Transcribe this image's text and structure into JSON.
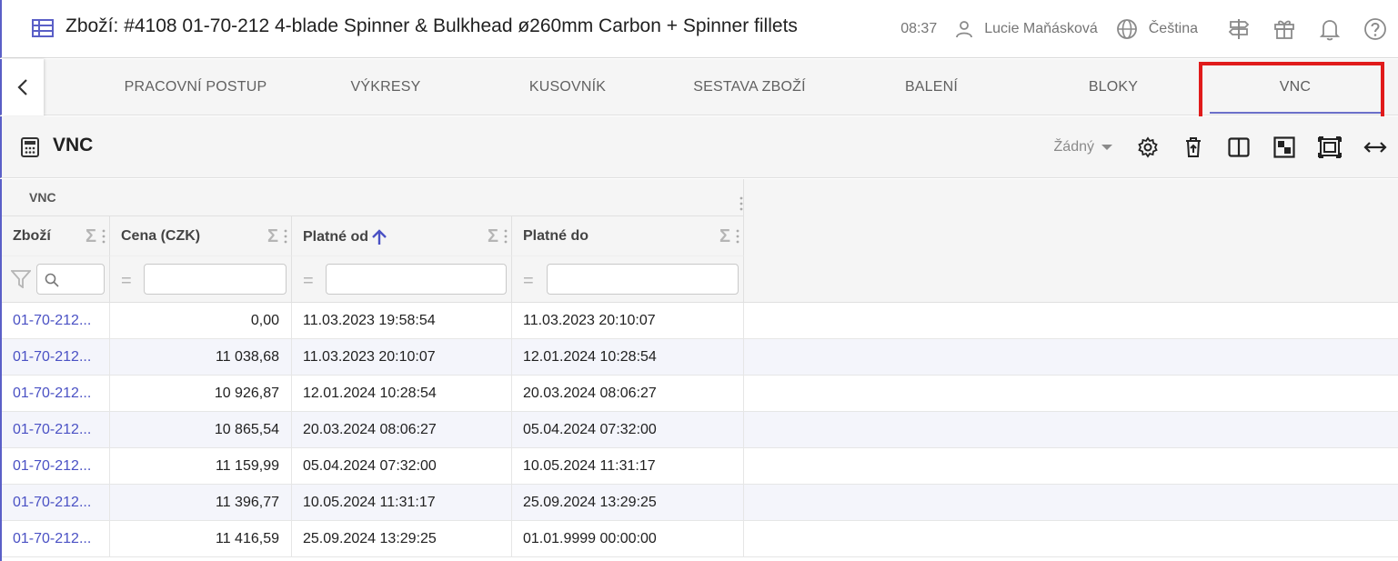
{
  "header": {
    "title": "Zboží: #4108 01-70-212 4-blade Spinner & Bulkhead ø260mm Carbon + Spinner fillets",
    "time": "08:37",
    "user": "Lucie Maňásková",
    "language": "Čeština",
    "icons": [
      "signpost-icon",
      "gift-icon",
      "bell-icon",
      "help-icon"
    ]
  },
  "tabs": [
    {
      "label": "PRACOVNÍ POSTUP"
    },
    {
      "label": "VÝKRESY"
    },
    {
      "label": "KUSOVNÍK"
    },
    {
      "label": "SESTAVA ZBOŽÍ"
    },
    {
      "label": "BALENÍ"
    },
    {
      "label": "BLOKY"
    },
    {
      "label": "VNC",
      "active": true
    }
  ],
  "panel": {
    "title": "VNC",
    "preset": "Žádný",
    "tool_icons": [
      "settings-icon",
      "delete-icon",
      "split-view-icon",
      "layout-icon",
      "fullscreen-icon",
      "expand-width-icon"
    ]
  },
  "grid": {
    "group_label": "VNC",
    "columns": [
      {
        "label": "Zboží"
      },
      {
        "label": "Cena (CZK)"
      },
      {
        "label": "Platné od",
        "sort": "asc"
      },
      {
        "label": "Platné do"
      }
    ],
    "rows": [
      {
        "item": "01-70-212...",
        "price": "0,00",
        "from": "11.03.2023 19:58:54",
        "to": "11.03.2023 20:10:07"
      },
      {
        "item": "01-70-212...",
        "price": "11 038,68",
        "from": "11.03.2023 20:10:07",
        "to": "12.01.2024 10:28:54"
      },
      {
        "item": "01-70-212...",
        "price": "10 926,87",
        "from": "12.01.2024 10:28:54",
        "to": "20.03.2024 08:06:27"
      },
      {
        "item": "01-70-212...",
        "price": "10 865,54",
        "from": "20.03.2024 08:06:27",
        "to": "05.04.2024 07:32:00"
      },
      {
        "item": "01-70-212...",
        "price": "11 159,99",
        "from": "05.04.2024 07:32:00",
        "to": "10.05.2024 11:31:17"
      },
      {
        "item": "01-70-212...",
        "price": "11 396,77",
        "from": "10.05.2024 11:31:17",
        "to": "25.09.2024 13:29:25"
      },
      {
        "item": "01-70-212...",
        "price": "11 416,59",
        "from": "25.09.2024 13:29:25",
        "to": "01.01.9999 00:00:00"
      }
    ]
  },
  "colors": {
    "accent": "#5a5fc7",
    "link": "#4a51c4",
    "highlight": "#e01b1b"
  }
}
